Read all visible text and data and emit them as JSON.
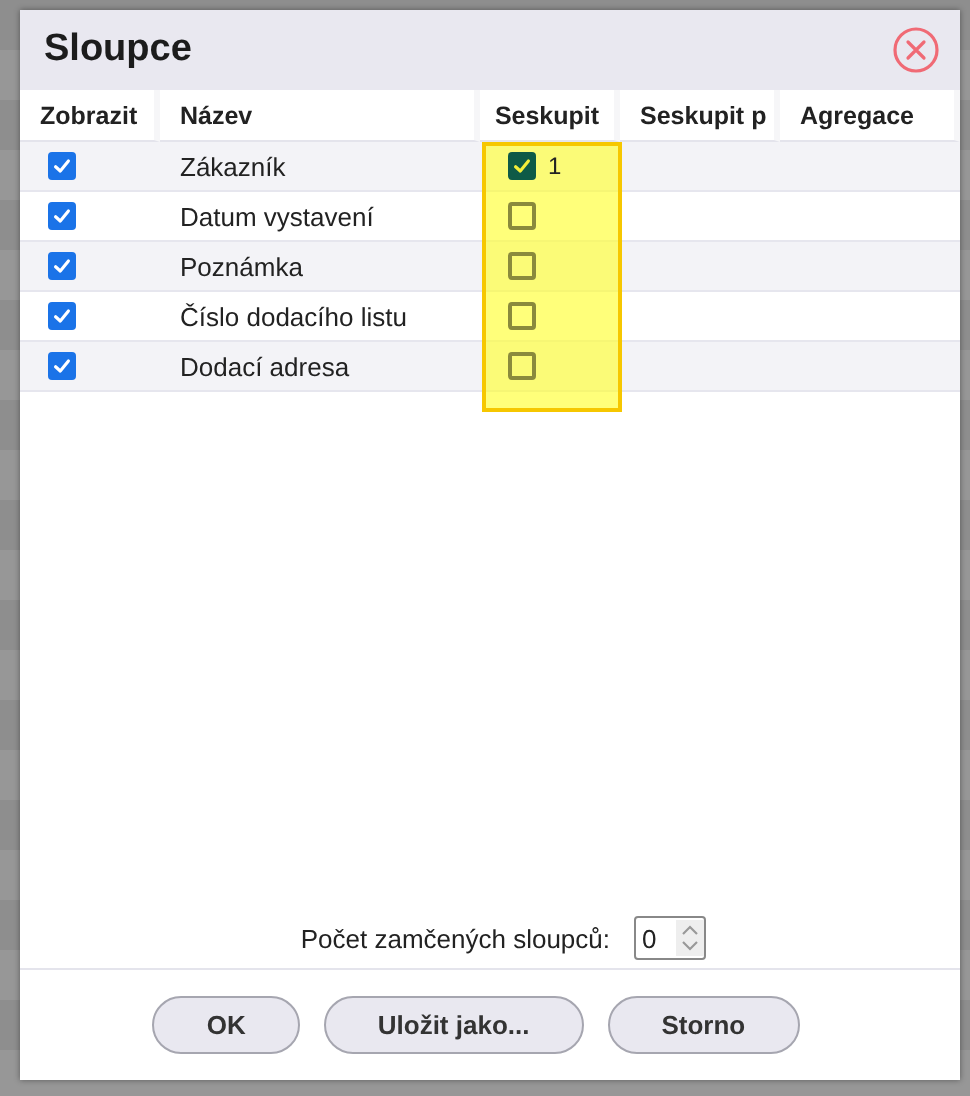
{
  "dialog": {
    "title": "Sloupce"
  },
  "columns": [
    {
      "label": "Zobrazit",
      "highlighted": false
    },
    {
      "label": "Název",
      "highlighted": false
    },
    {
      "label": "Seskupit",
      "highlighted": true
    },
    {
      "label": "Seskupit p",
      "highlighted": false
    },
    {
      "label": "Agregace",
      "highlighted": false
    }
  ],
  "rows": [
    {
      "name": "Zákazník",
      "visible": true,
      "grouped": true,
      "group_order": "1"
    },
    {
      "name": "Datum vystavení",
      "visible": true,
      "grouped": false
    },
    {
      "name": "Poznámka",
      "visible": true,
      "grouped": false
    },
    {
      "name": "Číslo dodacího listu",
      "visible": true,
      "grouped": false
    },
    {
      "name": "Dodací adresa",
      "visible": true,
      "grouped": false
    }
  ],
  "locked_columns": {
    "label": "Počet zamčených sloupců:",
    "value": "0"
  },
  "buttons": [
    {
      "label": "OK"
    },
    {
      "label": "Uložit jako..."
    },
    {
      "label": "Storno"
    }
  ]
}
